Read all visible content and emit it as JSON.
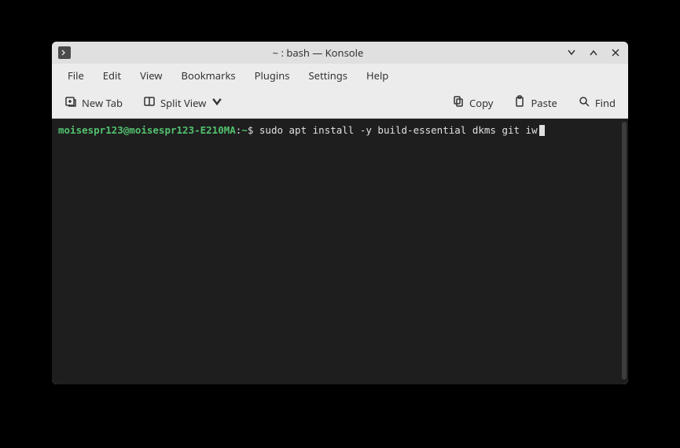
{
  "window": {
    "title": "~ : bash — Konsole"
  },
  "menubar": {
    "items": [
      "File",
      "Edit",
      "View",
      "Bookmarks",
      "Plugins",
      "Settings",
      "Help"
    ]
  },
  "toolbar": {
    "new_tab": "New Tab",
    "split_view": "Split View",
    "copy": "Copy",
    "paste": "Paste",
    "find": "Find"
  },
  "terminal": {
    "prompt_user_host": "moisespr123@moisespr123-E210MA",
    "prompt_separator": ":",
    "prompt_path": "~",
    "prompt_symbol": "$",
    "command": "sudo apt install -y build-essential dkms git iw"
  }
}
